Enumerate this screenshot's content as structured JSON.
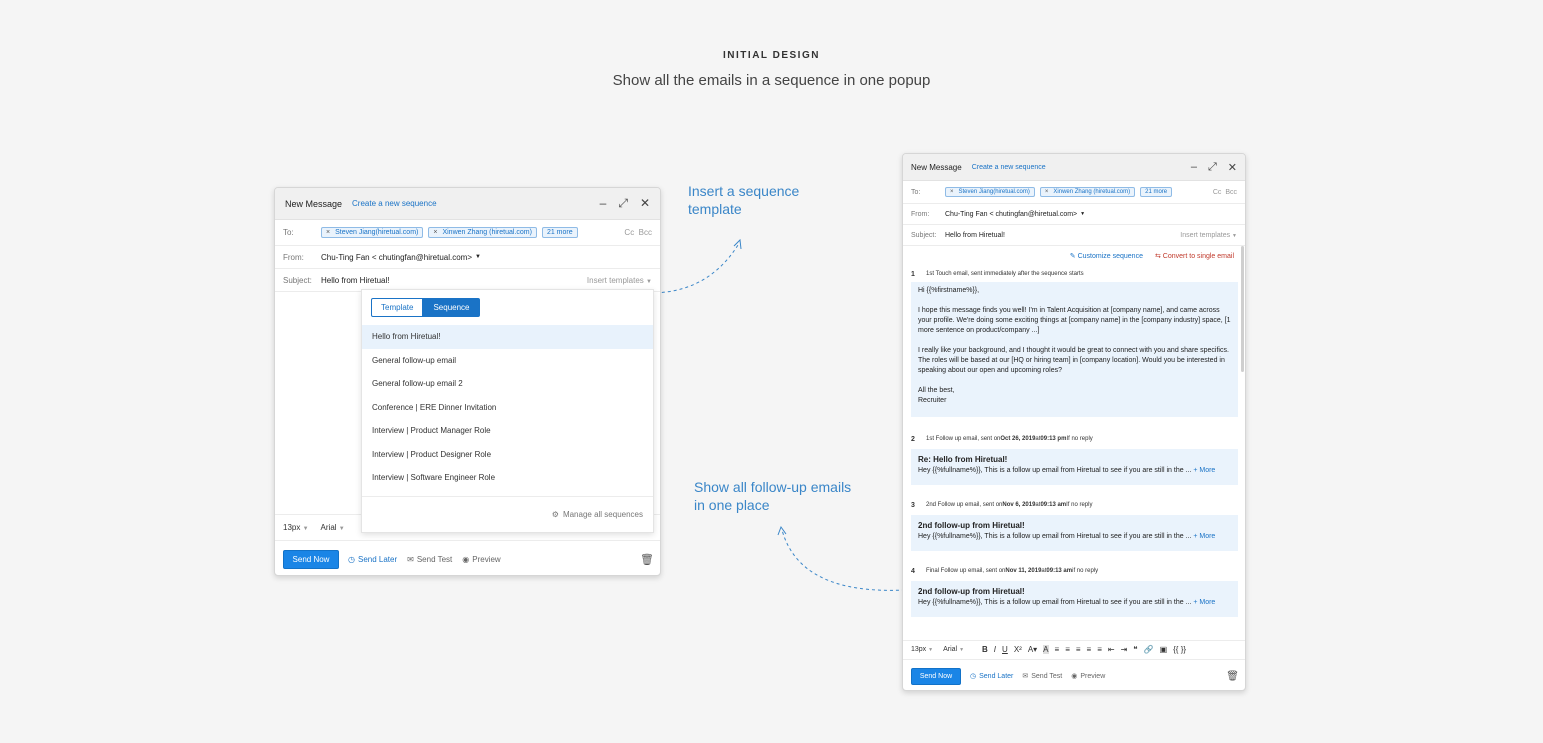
{
  "header": {
    "label": "INITIAL DESIGN",
    "subtitle": "Show all the emails in a sequence in one popup"
  },
  "annotations": {
    "insert": [
      "Insert a sequence",
      "template"
    ],
    "followup": [
      "Show all follow-up emails",
      "in one place"
    ]
  },
  "left": {
    "title": "New Message",
    "create_link": "Create a new sequence",
    "to_label": "To:",
    "recipients": [
      "Steven Jiang(hiretual.com)",
      "Xinwen Zhang (hiretual.com)"
    ],
    "more": "21 more",
    "cc": "Cc",
    "bcc": "Bcc",
    "from_label": "From:",
    "from_value": "Chu-Ting Fan < chutingfan@hiretual.com>",
    "subject_label": "Subject:",
    "subject_value": "Hello from Hiretual!",
    "insert_templates": "Insert templates",
    "tab_template": "Template",
    "tab_sequence": "Sequence",
    "sequences": [
      "Hello from Hiretual!",
      "General follow-up email",
      "General follow-up email 2",
      "Conference | ERE Dinner Invitation",
      "Interview | Product Manager Role",
      "Interview | Product Designer Role",
      "Interview | Software Engineer Role"
    ],
    "manage": "Manage all sequences",
    "font_size": "13px",
    "font": "Arial",
    "send_now": "Send Now",
    "send_later": "Send Later",
    "send_test": "Send Test",
    "preview": "Preview"
  },
  "right": {
    "title": "New Message",
    "create_link": "Create a new sequence",
    "to_label": "To:",
    "recipients": [
      "Steven Jiang(hiretual.com)",
      "Xinwen Zhang (hiretual.com)"
    ],
    "more": "21 more",
    "cc": "Cc",
    "bcc": "Bcc",
    "from_label": "From:",
    "from_value": "Chu-Ting Fan < chutingfan@hiretual.com>",
    "subject_label": "Subject:",
    "subject_value": "Hello from Hiretual!",
    "insert_templates": "Insert templates",
    "customize": "Customize sequence",
    "convert": "Convert to single email",
    "step1": {
      "num": "1",
      "desc": "1st Touch email, sent immediately after the sequence starts",
      "body": [
        "Hi {{%firstname%}},",
        "",
        "I hope this message finds you well! I'm in Talent Acquisition at [company name], and came across your profile. We're doing some exciting things at [company name] in the [company industry] space, [1 more sentence on product/company ...]",
        "",
        "I really like your background, and I thought it would be great to connect with you and share specifics. The roles will be based at our [HQ or hiring team] in [company location]. Would you be interested in speaking about our open and upcoming roles?",
        "",
        "All the best,",
        "Recruiter"
      ]
    },
    "followups": [
      {
        "num": "2",
        "pre": "1st Follow up email, sent on ",
        "date": "Oct 26, 2019",
        "at": " at ",
        "time": "09:13 pm",
        "post": " If no reply",
        "subject": "Re: Hello from Hiretual!",
        "body": "Hey {{%fullname%}}, This is a follow up email from Hiretual to see if you are still in the ...",
        "more": "+ More"
      },
      {
        "num": "3",
        "pre": "2nd Follow up email, sent on ",
        "date": "Nov 6, 2019",
        "at": " at ",
        "time": "09:13 am",
        "post": " If no reply",
        "subject": "2nd follow-up from Hiretual!",
        "body": "Hey {{%fullname%}}, This is a follow up email from Hiretual to see if you are still in the ...",
        "more": "+ More"
      },
      {
        "num": "4",
        "pre": "Final Follow up email, sent on ",
        "date": "Nov 11, 2019",
        "at": " at ",
        "time": "09:13 am",
        "post": " if no reply",
        "subject": "2nd follow-up from Hiretual!",
        "body": "Hey {{%fullname%}}, This is a follow up email from Hiretual to see if you are still in the ...",
        "more": "+ More"
      }
    ],
    "font_size": "13px",
    "font": "Arial",
    "send_now": "Send Now",
    "send_later": "Send Later",
    "send_test": "Send Test",
    "preview": "Preview"
  }
}
